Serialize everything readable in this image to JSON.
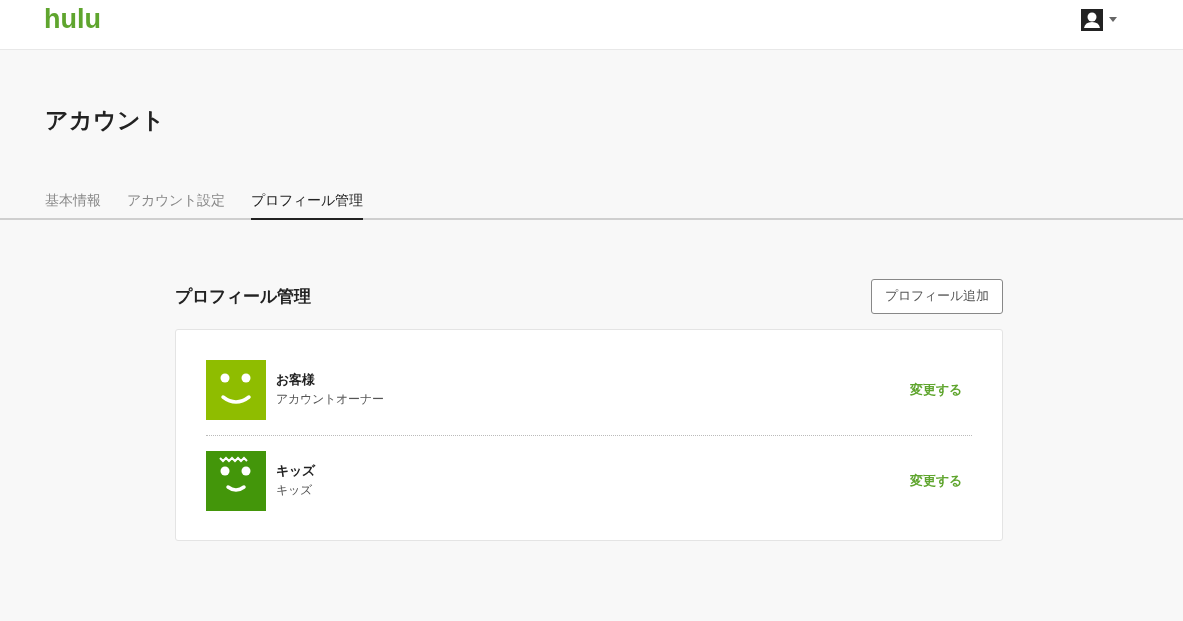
{
  "header": {
    "logo": "hulu"
  },
  "page_title": "アカウント",
  "tabs": [
    {
      "label": "基本情報",
      "selected": false
    },
    {
      "label": "アカウント設定",
      "selected": false
    },
    {
      "label": "プロフィール管理",
      "selected": true
    }
  ],
  "section": {
    "title": "プロフィール管理",
    "add_button": "プロフィール追加"
  },
  "profiles": [
    {
      "name": "お客様",
      "role": "アカウントオーナー",
      "kind": "adult",
      "color": "#8fbd00",
      "action": "変更する"
    },
    {
      "name": "キッズ",
      "role": "キッズ",
      "kind": "kids",
      "color": "#43960a",
      "action": "変更する"
    }
  ]
}
